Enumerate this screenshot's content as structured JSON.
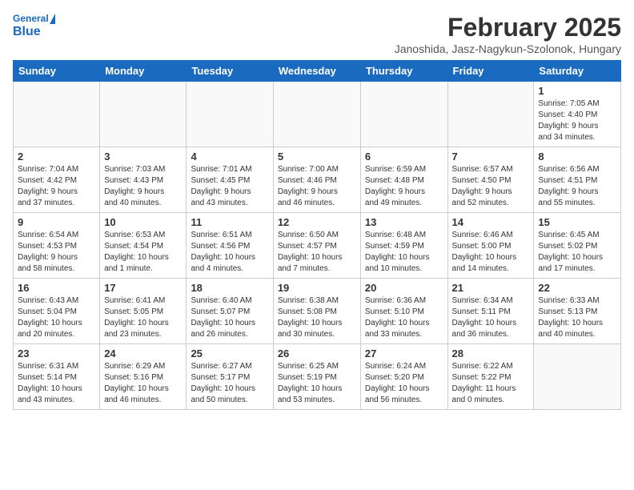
{
  "header": {
    "logo_line1": "General",
    "logo_line2": "Blue",
    "month": "February 2025",
    "location": "Janoshida, Jasz-Nagykun-Szolonok, Hungary"
  },
  "days_of_week": [
    "Sunday",
    "Monday",
    "Tuesday",
    "Wednesday",
    "Thursday",
    "Friday",
    "Saturday"
  ],
  "weeks": [
    [
      {
        "day": "",
        "info": ""
      },
      {
        "day": "",
        "info": ""
      },
      {
        "day": "",
        "info": ""
      },
      {
        "day": "",
        "info": ""
      },
      {
        "day": "",
        "info": ""
      },
      {
        "day": "",
        "info": ""
      },
      {
        "day": "1",
        "info": "Sunrise: 7:05 AM\nSunset: 4:40 PM\nDaylight: 9 hours\nand 34 minutes."
      }
    ],
    [
      {
        "day": "2",
        "info": "Sunrise: 7:04 AM\nSunset: 4:42 PM\nDaylight: 9 hours\nand 37 minutes."
      },
      {
        "day": "3",
        "info": "Sunrise: 7:03 AM\nSunset: 4:43 PM\nDaylight: 9 hours\nand 40 minutes."
      },
      {
        "day": "4",
        "info": "Sunrise: 7:01 AM\nSunset: 4:45 PM\nDaylight: 9 hours\nand 43 minutes."
      },
      {
        "day": "5",
        "info": "Sunrise: 7:00 AM\nSunset: 4:46 PM\nDaylight: 9 hours\nand 46 minutes."
      },
      {
        "day": "6",
        "info": "Sunrise: 6:59 AM\nSunset: 4:48 PM\nDaylight: 9 hours\nand 49 minutes."
      },
      {
        "day": "7",
        "info": "Sunrise: 6:57 AM\nSunset: 4:50 PM\nDaylight: 9 hours\nand 52 minutes."
      },
      {
        "day": "8",
        "info": "Sunrise: 6:56 AM\nSunset: 4:51 PM\nDaylight: 9 hours\nand 55 minutes."
      }
    ],
    [
      {
        "day": "9",
        "info": "Sunrise: 6:54 AM\nSunset: 4:53 PM\nDaylight: 9 hours\nand 58 minutes."
      },
      {
        "day": "10",
        "info": "Sunrise: 6:53 AM\nSunset: 4:54 PM\nDaylight: 10 hours\nand 1 minute."
      },
      {
        "day": "11",
        "info": "Sunrise: 6:51 AM\nSunset: 4:56 PM\nDaylight: 10 hours\nand 4 minutes."
      },
      {
        "day": "12",
        "info": "Sunrise: 6:50 AM\nSunset: 4:57 PM\nDaylight: 10 hours\nand 7 minutes."
      },
      {
        "day": "13",
        "info": "Sunrise: 6:48 AM\nSunset: 4:59 PM\nDaylight: 10 hours\nand 10 minutes."
      },
      {
        "day": "14",
        "info": "Sunrise: 6:46 AM\nSunset: 5:00 PM\nDaylight: 10 hours\nand 14 minutes."
      },
      {
        "day": "15",
        "info": "Sunrise: 6:45 AM\nSunset: 5:02 PM\nDaylight: 10 hours\nand 17 minutes."
      }
    ],
    [
      {
        "day": "16",
        "info": "Sunrise: 6:43 AM\nSunset: 5:04 PM\nDaylight: 10 hours\nand 20 minutes."
      },
      {
        "day": "17",
        "info": "Sunrise: 6:41 AM\nSunset: 5:05 PM\nDaylight: 10 hours\nand 23 minutes."
      },
      {
        "day": "18",
        "info": "Sunrise: 6:40 AM\nSunset: 5:07 PM\nDaylight: 10 hours\nand 26 minutes."
      },
      {
        "day": "19",
        "info": "Sunrise: 6:38 AM\nSunset: 5:08 PM\nDaylight: 10 hours\nand 30 minutes."
      },
      {
        "day": "20",
        "info": "Sunrise: 6:36 AM\nSunset: 5:10 PM\nDaylight: 10 hours\nand 33 minutes."
      },
      {
        "day": "21",
        "info": "Sunrise: 6:34 AM\nSunset: 5:11 PM\nDaylight: 10 hours\nand 36 minutes."
      },
      {
        "day": "22",
        "info": "Sunrise: 6:33 AM\nSunset: 5:13 PM\nDaylight: 10 hours\nand 40 minutes."
      }
    ],
    [
      {
        "day": "23",
        "info": "Sunrise: 6:31 AM\nSunset: 5:14 PM\nDaylight: 10 hours\nand 43 minutes."
      },
      {
        "day": "24",
        "info": "Sunrise: 6:29 AM\nSunset: 5:16 PM\nDaylight: 10 hours\nand 46 minutes."
      },
      {
        "day": "25",
        "info": "Sunrise: 6:27 AM\nSunset: 5:17 PM\nDaylight: 10 hours\nand 50 minutes."
      },
      {
        "day": "26",
        "info": "Sunrise: 6:25 AM\nSunset: 5:19 PM\nDaylight: 10 hours\nand 53 minutes."
      },
      {
        "day": "27",
        "info": "Sunrise: 6:24 AM\nSunset: 5:20 PM\nDaylight: 10 hours\nand 56 minutes."
      },
      {
        "day": "28",
        "info": "Sunrise: 6:22 AM\nSunset: 5:22 PM\nDaylight: 11 hours\nand 0 minutes."
      },
      {
        "day": "",
        "info": ""
      }
    ]
  ]
}
